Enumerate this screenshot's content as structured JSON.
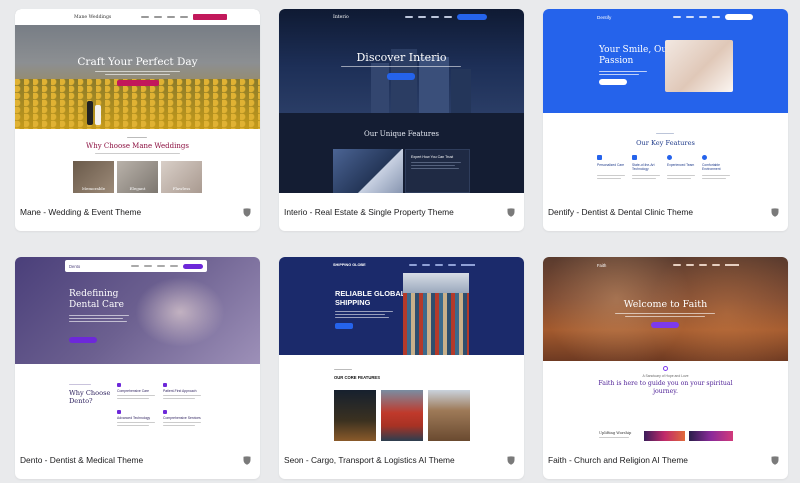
{
  "cards": [
    {
      "title": "Mane - Wedding & Event Theme",
      "preview": {
        "logo": "Mane Weddings",
        "heading": "Craft Your Perfect Day",
        "section_heading": "Why Choose Mane Weddings",
        "tiles": [
          "Memorable",
          "Elegant",
          "Flawless"
        ]
      },
      "colors": {
        "accent": "#c2185b",
        "heading": "#8c1040"
      }
    },
    {
      "title": "Interio - Real Estate & Single Property Theme",
      "preview": {
        "logo": "Interio",
        "heading": "Discover Interio",
        "section_heading": "Our Unique Features",
        "feature_label": "Expert How You Can Trust"
      },
      "colors": {
        "bg": "#111a2e",
        "accent": "#2563eb"
      }
    },
    {
      "title": "Dentify - Dentist & Dental Clinic Theme",
      "preview": {
        "logo": "Dentify",
        "heading_line1": "Your Smile, Our",
        "heading_line2": "Passion",
        "section_heading": "Our Key Features",
        "features": [
          "Personalized Care",
          "State-of-the-Art Technology",
          "Experienced Team",
          "Comfortable Environment"
        ]
      },
      "colors": {
        "hero": "#2563eb",
        "heading": "#1e3a8a"
      }
    },
    {
      "title": "Dento - Dentist & Medical Theme",
      "preview": {
        "logo": "Dento",
        "heading_line1": "Redefining",
        "heading_line2": "Dental Care",
        "section_heading_line1": "Why Choose",
        "section_heading_line2": "Dento?",
        "features": [
          "Comprehensive Care",
          "Patient-First Approach",
          "Advanced Technology",
          "Comprehensive Services"
        ]
      },
      "colors": {
        "accent": "#6d28d9",
        "hero": "#5a4e8a"
      }
    },
    {
      "title": "Seon - Cargo, Transport & Logistics AI Theme",
      "preview": {
        "logo": "SHIPPING GLOBE",
        "heading_line1": "RELIABLE GLOBAL",
        "heading_line2": "SHIPPING",
        "section_heading": "OUR CORE FEATURES"
      },
      "colors": {
        "hero": "#1b2a6b",
        "accent": "#2563eb"
      }
    },
    {
      "title": "Faith - Church and Religion AI Theme",
      "preview": {
        "logo": "Faith",
        "heading": "Welcome to Faith",
        "sub_label": "A Sanctuary of Hope and Love",
        "section_heading_line1": "Faith is here to guide you on your spiritual",
        "section_heading_line2": "journey.",
        "event_label": "Uplifting Worship"
      },
      "colors": {
        "accent": "#7c3aed",
        "heading": "#4c1d95"
      }
    }
  ],
  "icons": {
    "theme_badge": "shield-icon"
  }
}
